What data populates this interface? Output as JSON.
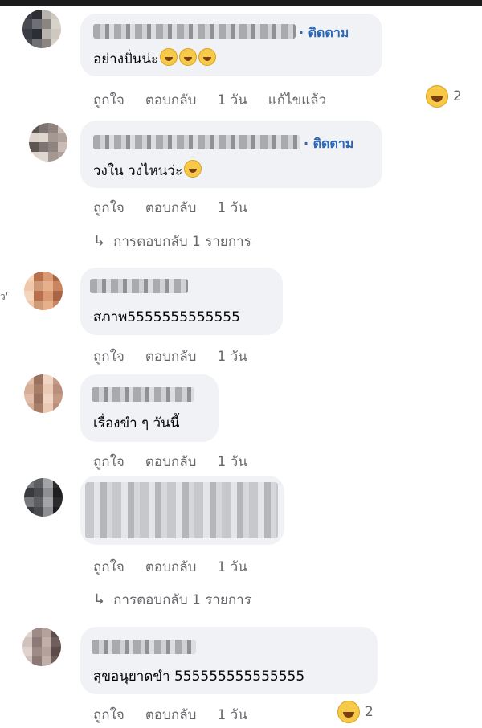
{
  "side_text": "ว'",
  "colors": {
    "link": "#2a65b6",
    "meta": "#65676b",
    "bubble": "#f0f2f5"
  },
  "comments": [
    {
      "follow": "· ติดตาม",
      "text": "อย่างปั่นน่ะ",
      "emoji_icons": [
        "grin-icon",
        "grin-icon",
        "grin-icon"
      ],
      "actions": {
        "like": "ถูกใจ",
        "reply": "ตอบกลับ",
        "time": "1 วัน",
        "edited": "แก้ไขแล้ว"
      },
      "reaction": {
        "icon": "laugh-emoji-icon",
        "count": "2"
      }
    },
    {
      "follow": "· ติดตาม",
      "text": "วงใน วงไหนว่ะ",
      "emoji_icons": [
        "rofl-icon"
      ],
      "actions": {
        "like": "ถูกใจ",
        "reply": "ตอบกลับ",
        "time": "1 วัน"
      },
      "replies": "การตอบกลับ 1 รายการ"
    },
    {
      "text": "สภาพ5555555555555",
      "actions": {
        "like": "ถูกใจ",
        "reply": "ตอบกลับ",
        "time": "1 วัน"
      }
    },
    {
      "text": "เรื่องขำ ๆ วันนี้",
      "actions": {
        "like": "ถูกใจ",
        "reply": "ตอบกลับ",
        "time": "1 วัน"
      }
    },
    {
      "actions": {
        "like": "ถูกใจ",
        "reply": "ตอบกลับ",
        "time": "1 วัน"
      },
      "replies": "การตอบกลับ 1 รายการ"
    },
    {
      "text": "สุขอนุยาดขำ 555555555555555",
      "actions": {
        "like": "ถูกใจ",
        "reply": "ตอบกลับ",
        "time": "1 วัน"
      },
      "reaction": {
        "icon": "laugh-emoji-icon",
        "count": "2"
      }
    }
  ]
}
